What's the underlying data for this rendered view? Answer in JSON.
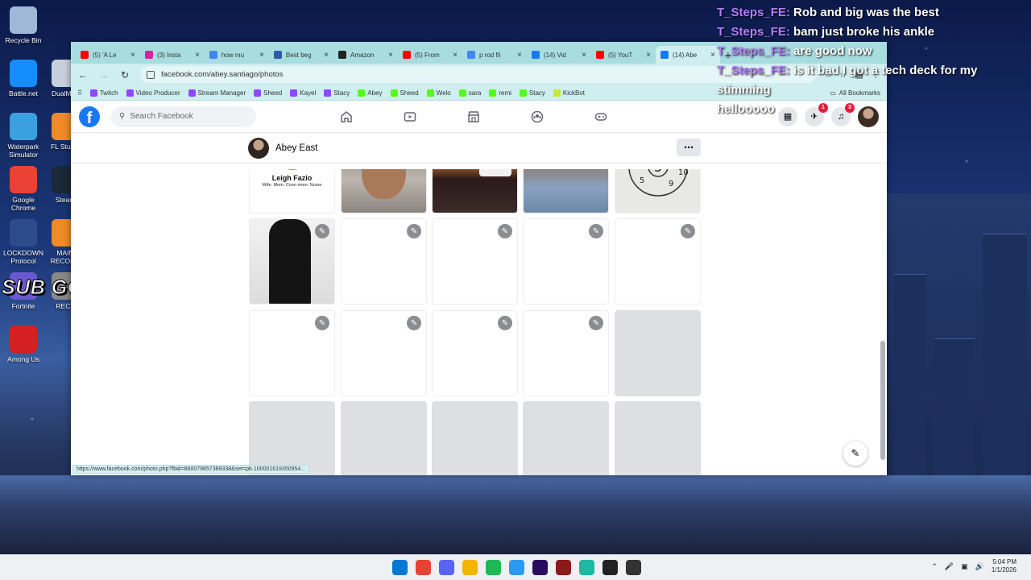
{
  "overlay": {
    "sub_goal": "SUB GOAL 319/320",
    "chat": [
      {
        "user": "T_Steps_FE:",
        "message": "Rob and big was the best"
      },
      {
        "user": "T_Steps_FE:",
        "message": "bam just broke his ankle"
      },
      {
        "user": "T_Steps_FE:",
        "message": "are good now"
      },
      {
        "user": "T_Steps_FE:",
        "message": "is it bad I got a tech deck for my stimming"
      },
      {
        "user": "",
        "message": "hellooooo"
      }
    ]
  },
  "desktop_icons": [
    {
      "label": "Recycle Bin",
      "icon": "recycle-bin-icon",
      "color": "#9fb8d8"
    },
    {
      "label": "Battle.net",
      "icon": "battlenet-icon",
      "color": "#148eff"
    },
    {
      "label": "DualMon",
      "icon": "dualmon-icon",
      "color": "#c8d0dc"
    },
    {
      "label": "Waterpark Simulator",
      "icon": "waterpark-icon",
      "color": "#3aa0e0"
    },
    {
      "label": "FL Studio",
      "icon": "fl-studio-icon",
      "color": "#f08a24"
    },
    {
      "label": "Google Chrome",
      "icon": "chrome-icon",
      "color": "#e94235"
    },
    {
      "label": "Steam",
      "icon": "steam-icon",
      "color": "#1b2838"
    },
    {
      "label": "LOCKDOWN Protocol",
      "icon": "lockdown-icon",
      "color": "#2c4c8c"
    },
    {
      "label": "MAIN RECORD",
      "icon": "fl-studio-icon",
      "color": "#f08a24"
    },
    {
      "label": "Fortnite",
      "icon": "fortnite-icon",
      "color": "#6a5acd"
    },
    {
      "label": "RECT",
      "icon": "app-icon",
      "color": "#888888"
    },
    {
      "label": "Among Us",
      "icon": "among-us-icon",
      "color": "#d42020"
    }
  ],
  "browser": {
    "tabs": [
      {
        "title": "(5) 'A Le",
        "icon": "youtube-icon",
        "color": "#ff0000"
      },
      {
        "title": "(3) Insta",
        "icon": "instagram-icon",
        "color": "#d6249f"
      },
      {
        "title": "how mu",
        "icon": "google-icon",
        "color": "#4285f4"
      },
      {
        "title": "Best beg",
        "icon": "site-icon",
        "color": "#2a5caa"
      },
      {
        "title": "Amazon",
        "icon": "amazon-icon",
        "color": "#222222"
      },
      {
        "title": "(5) From",
        "icon": "youtube-icon",
        "color": "#ff0000"
      },
      {
        "title": "p rod fli",
        "icon": "google-icon",
        "color": "#4285f4"
      },
      {
        "title": "(14) Vid",
        "icon": "facebook-icon",
        "color": "#1877f2"
      },
      {
        "title": "(5) YouT",
        "icon": "youtube-icon",
        "color": "#ff0000"
      },
      {
        "title": "(14) Abe",
        "icon": "facebook-icon",
        "color": "#1877f2",
        "active": true
      }
    ],
    "url": "facebook.com/abey.santiago/photos",
    "bookmarks": [
      {
        "label": "Twitch",
        "color": "#9146ff"
      },
      {
        "label": "Video Producer",
        "color": "#9146ff"
      },
      {
        "label": "Stream Manager",
        "color": "#9146ff"
      },
      {
        "label": "Sheed",
        "color": "#9146ff"
      },
      {
        "label": "Kayel",
        "color": "#9146ff"
      },
      {
        "label": "Stacy",
        "color": "#9146ff"
      },
      {
        "label": "Abey",
        "color": "#53fc18"
      },
      {
        "label": "Sheed",
        "color": "#53fc18"
      },
      {
        "label": "Welo",
        "color": "#53fc18"
      },
      {
        "label": "sara",
        "color": "#53fc18"
      },
      {
        "label": "remi",
        "color": "#53fc18"
      },
      {
        "label": "Stacy",
        "color": "#53fc18"
      },
      {
        "label": "KickBot",
        "color": "#c8e830"
      }
    ],
    "all_bookmarks": "All Bookmarks",
    "status_url": "https://www.facebook.com/photo.php?fbid=860079657389338&set=pb.100001619350954..."
  },
  "facebook": {
    "search_placeholder": "Search Facebook",
    "notification_badge": "3",
    "messenger_badge": "1",
    "profile_name": "Abey East",
    "brand_color": "#1877f2",
    "photo_tiles": [
      {
        "kind": "leigh",
        "name": "Leigh Fazio",
        "bio": "Wife. Mom. Coon mom. Nurse"
      },
      {
        "kind": "face"
      },
      {
        "kind": "sunset"
      },
      {
        "kind": "people"
      },
      {
        "kind": "wheel",
        "numbers": [
          "3",
          "4",
          "P",
          "2",
          "5",
          "10",
          "5",
          "9"
        ]
      },
      {
        "kind": "dark",
        "editable": true
      },
      {
        "kind": "blank",
        "editable": true
      },
      {
        "kind": "blank",
        "editable": true
      },
      {
        "kind": "blank",
        "editable": true
      },
      {
        "kind": "blank",
        "editable": true
      },
      {
        "kind": "blank",
        "editable": true
      },
      {
        "kind": "blank",
        "editable": true
      },
      {
        "kind": "blank",
        "editable": true
      },
      {
        "kind": "blank",
        "editable": true
      },
      {
        "kind": "grey"
      },
      {
        "kind": "grey"
      },
      {
        "kind": "grey"
      },
      {
        "kind": "grey"
      },
      {
        "kind": "grey"
      },
      {
        "kind": "grey"
      }
    ]
  },
  "taskbar": {
    "time": "5:04 PM",
    "date": "1/1/2026",
    "apps": [
      {
        "icon": "windows-start-icon",
        "color": "#0078d4"
      },
      {
        "icon": "chrome-icon",
        "color": "#e94235"
      },
      {
        "icon": "discord-icon",
        "color": "#5865f2"
      },
      {
        "icon": "file-explorer-icon",
        "color": "#f4b400"
      },
      {
        "icon": "spotify-icon",
        "color": "#1db954"
      },
      {
        "icon": "app-icon",
        "color": "#2b9af3"
      },
      {
        "icon": "premiere-icon",
        "color": "#2a0a5e"
      },
      {
        "icon": "game-icon",
        "color": "#8b1a1a"
      },
      {
        "icon": "app-icon",
        "color": "#1fb8a0"
      },
      {
        "icon": "app-icon",
        "color": "#222222"
      },
      {
        "icon": "call-of-duty-icon",
        "color": "#333333"
      }
    ]
  }
}
